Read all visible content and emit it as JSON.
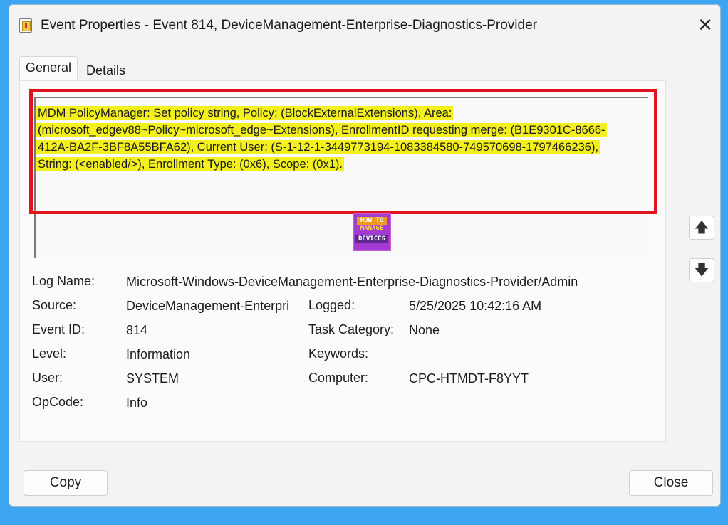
{
  "window": {
    "title": "Event Properties - Event 814, DeviceManagement-Enterprise-Diagnostics-Provider"
  },
  "tabs": [
    {
      "label": "General"
    },
    {
      "label": "Details"
    }
  ],
  "description": "MDM PolicyManager: Set policy string, Policy: (BlockExternalExtensions), Area: (microsoft_edgev88~Policy~microsoft_edge~Extensions), EnrollmentID requesting merge: (B1E9301C-8666-412A-BA2F-3BF8A55BFA62), Current User: (S-1-12-1-3449773194-1083384580-749570698-1797466236), String: (<enabled/>), Enrollment Type: (0x6), Scope: (0x1).",
  "watermark": {
    "top": "HOW TO",
    "middle": "MANAGE",
    "bottom": "DEVICES"
  },
  "fields": {
    "log_name": {
      "label": "Log Name:",
      "value": "Microsoft-Windows-DeviceManagement-Enterprise-Diagnostics-Provider/Admin"
    },
    "source": {
      "label": "Source:",
      "value": "DeviceManagement-Enterpri"
    },
    "logged": {
      "label": "Logged:",
      "value": "5/25/2025 10:42:16 AM"
    },
    "event_id": {
      "label": "Event ID:",
      "value": "814"
    },
    "task_category": {
      "label": "Task Category:",
      "value": "None"
    },
    "level": {
      "label": "Level:",
      "value": "Information"
    },
    "keywords": {
      "label": "Keywords:",
      "value": ""
    },
    "user": {
      "label": "User:",
      "value": "SYSTEM"
    },
    "computer": {
      "label": "Computer:",
      "value": "CPC-HTMDT-F8YYT"
    },
    "opcode": {
      "label": "OpCode:",
      "value": "Info"
    }
  },
  "buttons": {
    "copy": "Copy",
    "close": "Close"
  },
  "icons": {
    "close": "✕",
    "arrow_up": "🡅",
    "arrow_down": "🡇"
  },
  "colors": {
    "highlight": "#f3f01e",
    "annotation_red": "#e0141c",
    "background": "#3da6f2"
  }
}
